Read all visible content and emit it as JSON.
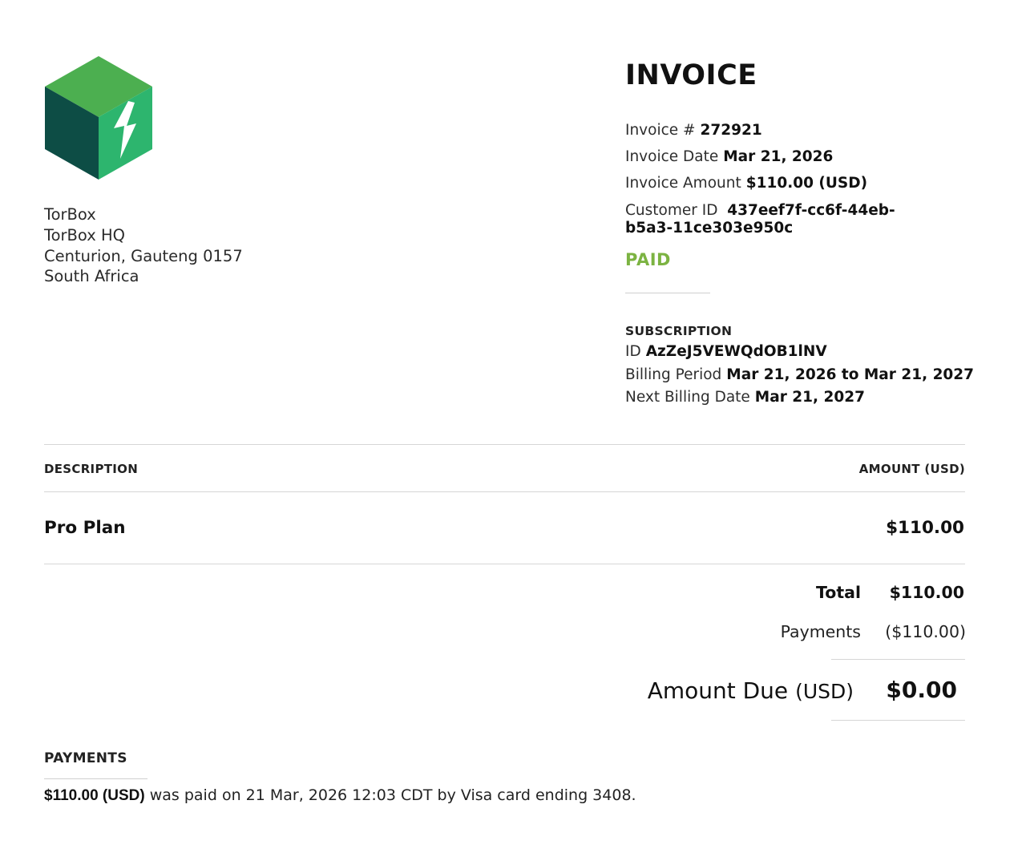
{
  "company": {
    "name": "TorBox",
    "address_line1": "TorBox HQ",
    "address_line2": "Centurion, Gauteng 0157",
    "country": "South Africa"
  },
  "colors": {
    "cube_top": "#4caf50",
    "cube_left": "#0d4d45",
    "cube_right": "#2db56e",
    "paid": "#7cb342"
  },
  "invoice": {
    "title": "INVOICE",
    "number_label": "Invoice #",
    "number": "272921",
    "date_label": "Invoice Date",
    "date": "Mar 21, 2026",
    "amount_label": "Invoice Amount",
    "amount": "$110.00 (USD)",
    "customer_label": "Customer ID",
    "customer_id": "437eef7f-cc6f-44eb-b5a3-11ce303e950c",
    "status": "PAID"
  },
  "subscription": {
    "heading": "SUBSCRIPTION",
    "id_label": "ID",
    "id": "AzZeJ5VEWQdOB1lNV",
    "period_label": "Billing Period",
    "period": "Mar 21, 2026 to Mar 21, 2027",
    "next_label": "Next Billing Date",
    "next": "Mar 21, 2027"
  },
  "table": {
    "description_header": "DESCRIPTION",
    "amount_header": "AMOUNT (USD)",
    "items": [
      {
        "description": "Pro Plan",
        "amount": "$110.00"
      }
    ]
  },
  "totals": {
    "total_label": "Total",
    "total": "$110.00",
    "payments_label": "Payments",
    "payments": "($110.00)",
    "due_label": "Amount Due",
    "due_currency": "(USD)",
    "due": "$0.00"
  },
  "payments_section": {
    "heading": "PAYMENTS",
    "amount": "$110.00 (USD)",
    "text": "was paid on 21 Mar, 2026 12:03 CDT by Visa card ending 3408."
  }
}
